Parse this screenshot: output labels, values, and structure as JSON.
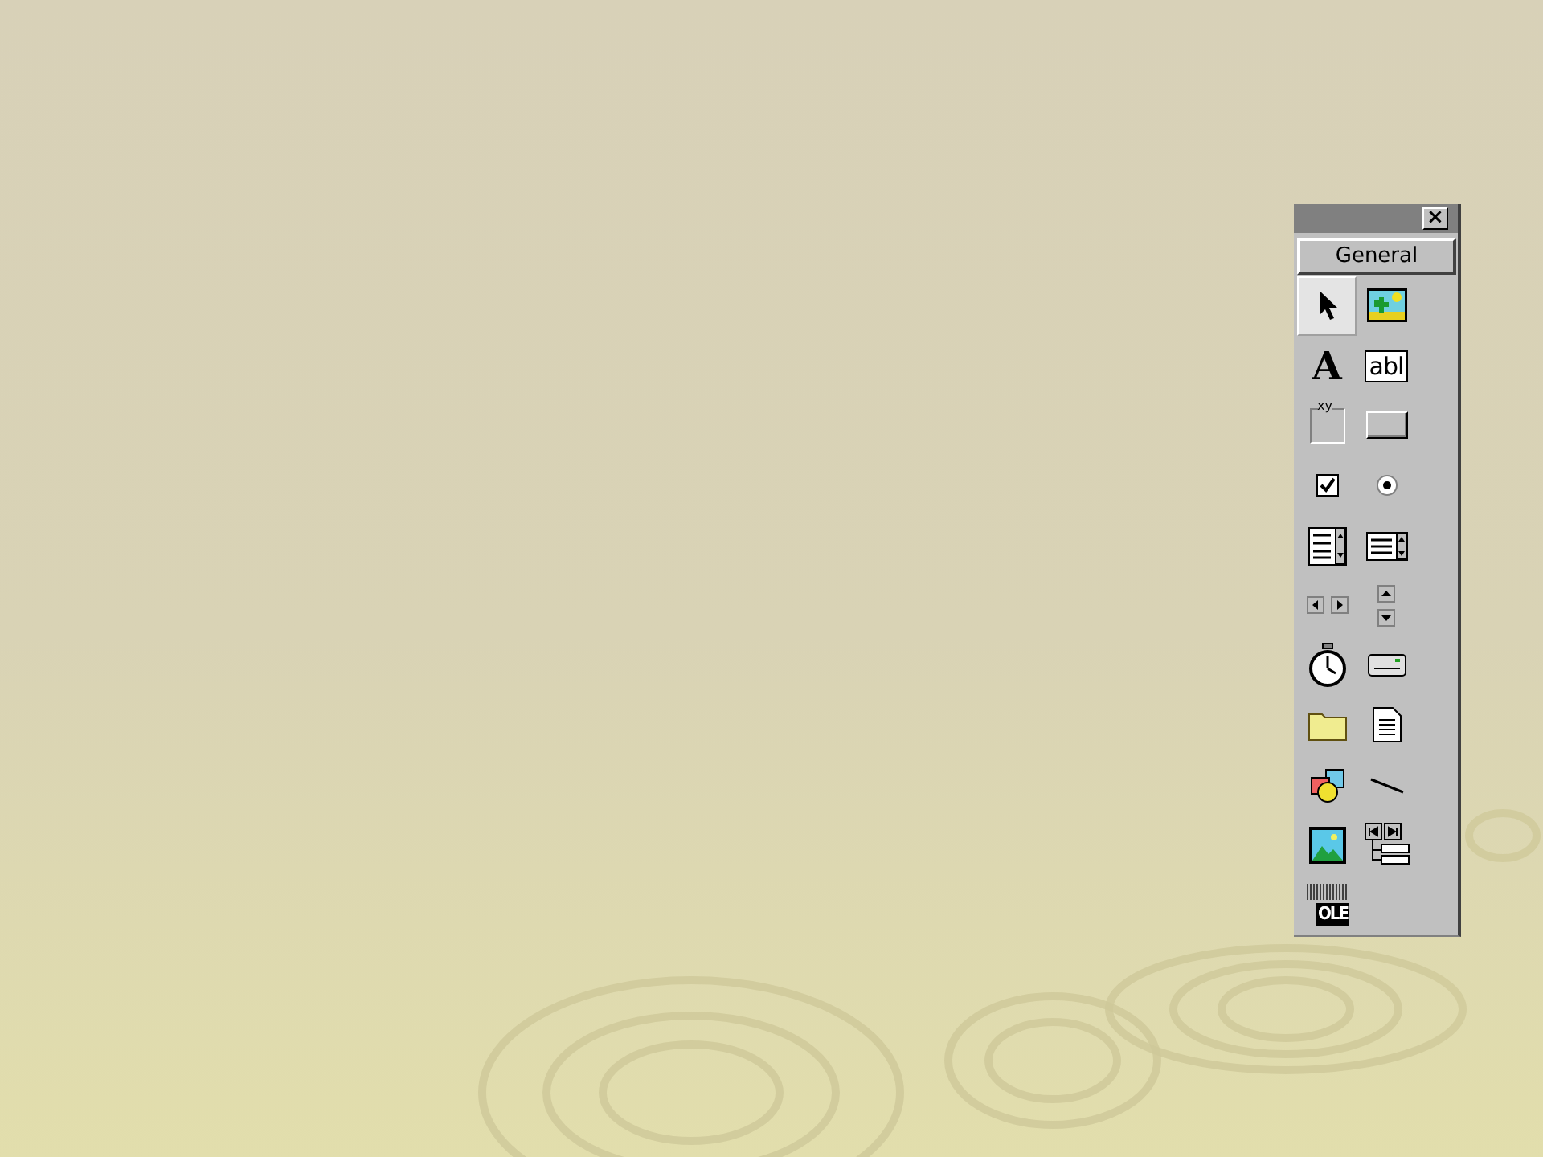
{
  "toolbox": {
    "close": "×",
    "tab": "General",
    "tools": [
      {
        "kind": "pointer",
        "selected": true
      },
      {
        "kind": "picture",
        "selected": false
      },
      {
        "kind": "label",
        "glyph": "A",
        "selected": false
      },
      {
        "kind": "textbox",
        "glyph": "abl",
        "selected": false
      },
      {
        "kind": "frame",
        "glyph": "xy",
        "selected": false
      },
      {
        "kind": "button",
        "selected": false
      },
      {
        "kind": "checkbox",
        "selected": false
      },
      {
        "kind": "radio",
        "selected": false
      },
      {
        "kind": "combobox",
        "selected": false
      },
      {
        "kind": "listbox",
        "selected": false
      },
      {
        "kind": "hscroll",
        "selected": false
      },
      {
        "kind": "vscroll",
        "selected": false
      },
      {
        "kind": "timer",
        "selected": false
      },
      {
        "kind": "drive",
        "selected": false
      },
      {
        "kind": "folder",
        "selected": false
      },
      {
        "kind": "file",
        "selected": false
      },
      {
        "kind": "shape",
        "selected": false
      },
      {
        "kind": "line",
        "selected": false
      },
      {
        "kind": "image",
        "selected": false
      },
      {
        "kind": "data",
        "selected": false
      },
      {
        "kind": "ole",
        "glyph": "OLE",
        "selected": false
      }
    ]
  }
}
